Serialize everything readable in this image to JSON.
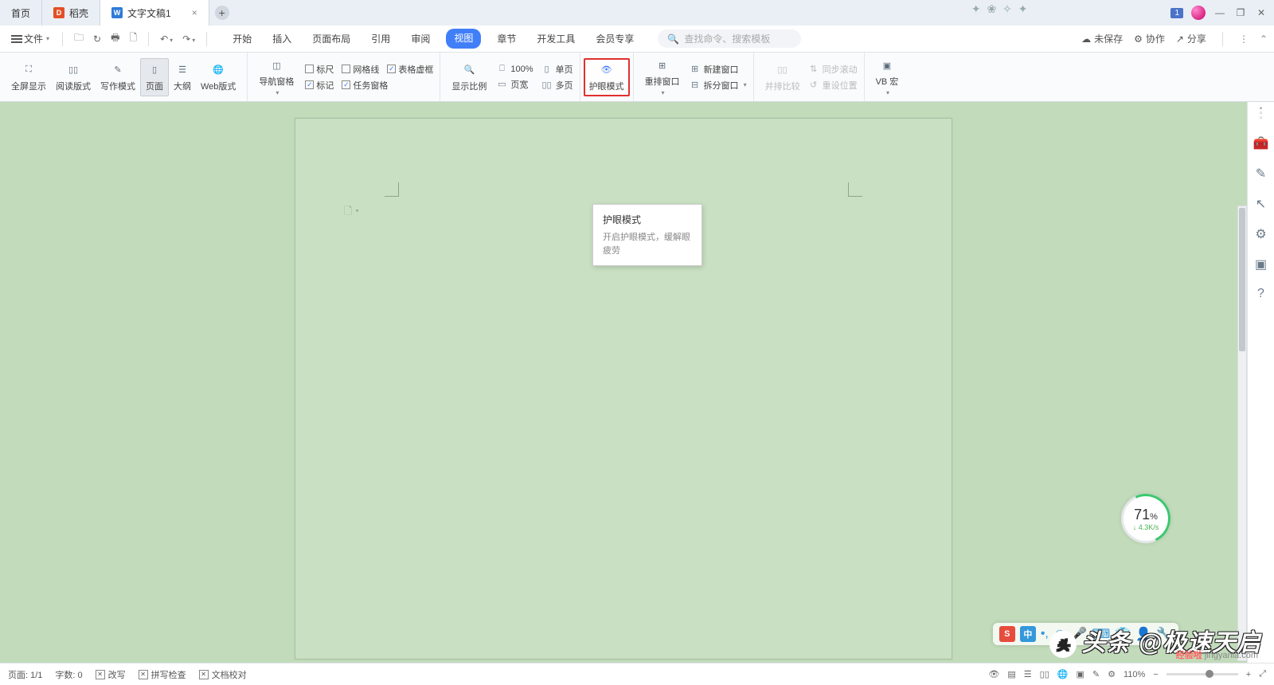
{
  "titlebar": {
    "tabs": [
      {
        "label": "首页"
      },
      {
        "label": "稻壳",
        "icon": "D"
      },
      {
        "label": "文字文稿1",
        "icon": "W",
        "close": "×"
      }
    ],
    "badge": "1",
    "minimize": "—",
    "restore": "❐",
    "close": "✕"
  },
  "menubar": {
    "file": "文件",
    "items": [
      "开始",
      "插入",
      "页面布局",
      "引用",
      "审阅",
      "视图",
      "章节",
      "开发工具",
      "会员专享"
    ],
    "active_index": 5,
    "search_placeholder": "查找命令、搜索模板",
    "unsaved": "未保存",
    "collab": "协作",
    "share": "分享"
  },
  "ribbon": {
    "g1": {
      "fullscreen": "全屏显示",
      "read": "阅读版式",
      "write": "写作模式",
      "page": "页面",
      "outline": "大纲",
      "web": "Web版式"
    },
    "g2": {
      "nav": "导航窗格",
      "ruler": "标尺",
      "grid": "网格线",
      "table": "表格虚框",
      "mark": "标记",
      "task": "任务窗格"
    },
    "g3": {
      "ratio": "显示比例",
      "hundred": "100%",
      "width": "页宽",
      "single": "单页",
      "multi": "多页"
    },
    "g4": {
      "eye": "护眼模式"
    },
    "g5": {
      "rearrange": "重排窗口",
      "newwin": "新建窗口",
      "split": "拆分窗口"
    },
    "g6": {
      "compare": "并排比较",
      "sync": "同步滚动",
      "reset": "重设位置"
    },
    "g7": {
      "macro": "VB 宏"
    }
  },
  "tooltip": {
    "title": "护眼模式",
    "desc1": "开启护眼模式，缓解眼",
    "desc2": "疲劳"
  },
  "meter": {
    "value": "71",
    "unit": "%",
    "rate": "↓ 4.3K/s"
  },
  "status": {
    "page": "页面: 1/1",
    "words": "字数: 0",
    "rewrite": "改写",
    "spell": "拼写检查",
    "doccheck": "文档校对",
    "zoom": "110%"
  },
  "overlay_cn": "中",
  "watermark": "头条 @极速天启",
  "watermark2": "经验啦",
  "watermark3": "jingyanla.com"
}
